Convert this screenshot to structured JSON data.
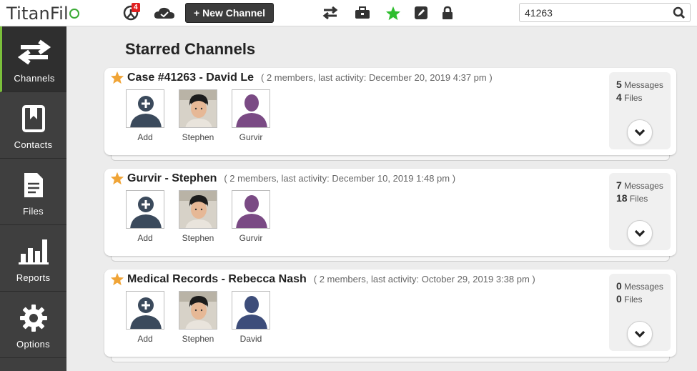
{
  "app": {
    "logo": "TitanFil"
  },
  "topbar": {
    "notifications_count": "4",
    "new_channel_label": "+ New Channel",
    "search_value": "41263",
    "accent_color": "#3aaa35"
  },
  "sidebar": {
    "items": [
      {
        "label": "Channels",
        "icon": "arrows-icon",
        "active": true
      },
      {
        "label": "Contacts",
        "icon": "bookmark-book-icon"
      },
      {
        "label": "Files",
        "icon": "document-icon"
      },
      {
        "label": "Reports",
        "icon": "bar-chart-icon"
      },
      {
        "label": "Options",
        "icon": "gear-icon"
      }
    ]
  },
  "main": {
    "title": "Starred Channels",
    "channels": [
      {
        "title": "Case #41263 - David Le",
        "meta": "( 2 members, last activity: December 20, 2019 4:37 pm )",
        "members": [
          "Add",
          "Stephen",
          "Gurvir"
        ],
        "messages": "5",
        "messages_label": "Messages",
        "files": "4",
        "files_label": "Files"
      },
      {
        "title": "Gurvir - Stephen",
        "meta": "( 2 members, last activity: December 10, 2019 1:48 pm )",
        "members": [
          "Add",
          "Stephen",
          "Gurvir"
        ],
        "messages": "7",
        "messages_label": "Messages",
        "files": "18",
        "files_label": "Files"
      },
      {
        "title": "Medical Records - Rebecca Nash",
        "meta": "( 2 members, last activity: October 29, 2019 3:38 pm )",
        "members": [
          "Add",
          "Stephen",
          "David"
        ],
        "messages": "0",
        "messages_label": "Messages",
        "files": "0",
        "files_label": "Files"
      }
    ]
  }
}
